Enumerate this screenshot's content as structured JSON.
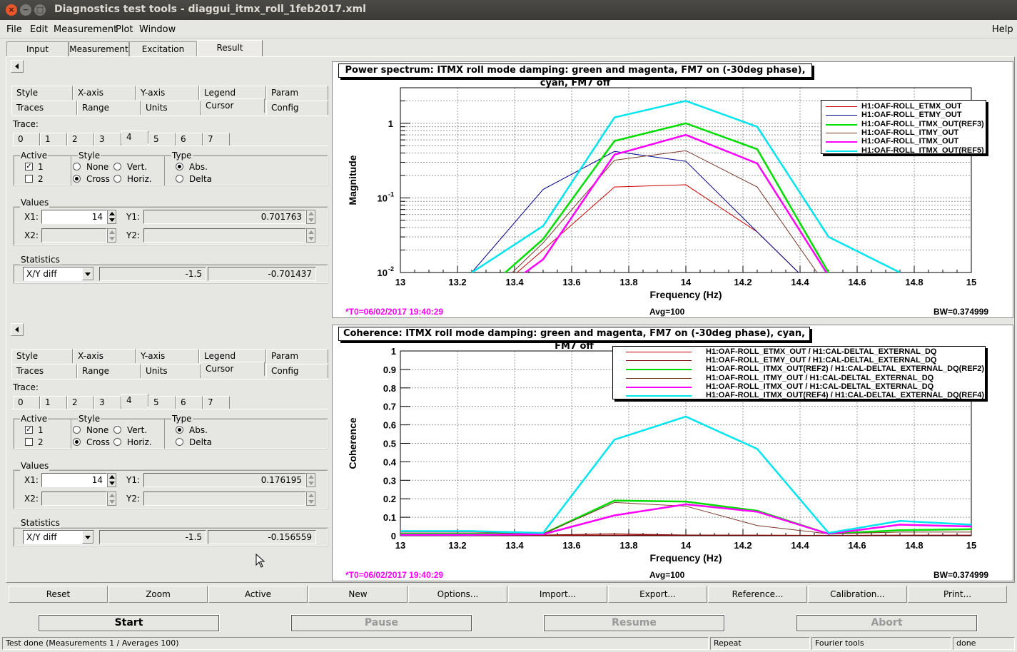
{
  "window": {
    "title": "Diagnostics test tools - diaggui_itmx_roll_1feb2017.xml",
    "controls": [
      "×",
      "−",
      "□"
    ]
  },
  "menubar": {
    "items": [
      "File",
      "Edit",
      "Measurement",
      "Plot",
      "Window"
    ],
    "help": "Help"
  },
  "main_tabs": [
    "Input",
    "Measurement",
    "Excitation",
    "Result"
  ],
  "panel_top": {
    "tabs_row1": [
      "Style",
      "X-axis",
      "Y-axis",
      "Legend",
      "Param"
    ],
    "tabs_row2": [
      "Traces",
      "Range",
      "Units",
      "Cursor",
      "Config"
    ],
    "trace_label": "Trace:",
    "trace_tabs": [
      "0",
      "1",
      "2",
      "3",
      "4",
      "5",
      "6",
      "7"
    ],
    "active_label": "Active",
    "active_1": "1",
    "active_2": "2",
    "style_label": "Style",
    "style_none": "None",
    "style_vert": "Vert.",
    "style_cross": "Cross",
    "style_horiz": "Horiz.",
    "type_label": "Type",
    "type_abs": "Abs.",
    "type_delta": "Delta",
    "values_label": "Values",
    "x1_label": "X1:",
    "x1_value": "14",
    "y1_label": "Y1:",
    "y1_value": "0.701763",
    "x2_label": "X2:",
    "y2_label": "Y2:",
    "statistics_label": "Statistics",
    "stat_select": "X/Y diff",
    "stat_val1": "-1.5",
    "stat_val2": "-0.701437"
  },
  "panel_bottom": {
    "tabs_row1": [
      "Style",
      "X-axis",
      "Y-axis",
      "Legend",
      "Param"
    ],
    "tabs_row2": [
      "Traces",
      "Range",
      "Units",
      "Cursor",
      "Config"
    ],
    "trace_label": "Trace:",
    "trace_tabs": [
      "0",
      "1",
      "2",
      "3",
      "4",
      "5",
      "6",
      "7"
    ],
    "active_label": "Active",
    "active_1": "1",
    "active_2": "2",
    "style_label": "Style",
    "style_none": "None",
    "style_vert": "Vert.",
    "style_cross": "Cross",
    "style_horiz": "Horiz.",
    "type_label": "Type",
    "type_abs": "Abs.",
    "type_delta": "Delta",
    "values_label": "Values",
    "x1_label": "X1:",
    "x1_value": "14",
    "y1_label": "Y1:",
    "y1_value": "0.176195",
    "x2_label": "X2:",
    "y2_label": "Y2:",
    "statistics_label": "Statistics",
    "stat_select": "X/Y diff",
    "stat_val1": "-1.5",
    "stat_val2": "-0.156559"
  },
  "plot_top": {
    "t0": "*T0=06/02/2017 19:40:29",
    "avg": "Avg=100",
    "bw": "BW=0.374999"
  },
  "plot_bottom": {
    "t0": "*T0=06/02/2017 19:40:29",
    "avg": "Avg=100",
    "bw": "BW=0.374999"
  },
  "button_bar": [
    "Reset",
    "Zoom",
    "Active",
    "New",
    "Options...",
    "Import...",
    "Export...",
    "Reference...",
    "Calibration...",
    "Print..."
  ],
  "control_buttons": [
    "Start",
    "Pause",
    "Resume",
    "Abort"
  ],
  "status": {
    "message": "Test done (Measurements 1 / Averages 100)",
    "repeat": "Repeat",
    "tools": "Fourier tools",
    "state": "done"
  },
  "colors": {
    "magenta": "#ff00ff",
    "cyan": "#00e5ee",
    "green": "#00dd00"
  },
  "chart_data": [
    {
      "type": "line",
      "title": "Power spectrum: ITMX roll mode damping: green and magenta, FM7 on (-30deg phase), cyan, FM7 off",
      "xlabel": "Frequency (Hz)",
      "ylabel": "Magnitude",
      "yscale": "log",
      "xlim": [
        13,
        15
      ],
      "ylim": [
        0.01,
        3
      ],
      "xticks": [
        "13",
        "13.2",
        "13.4",
        "13.6",
        "13.8",
        "14",
        "14.2",
        "14.4",
        "14.6",
        "14.8",
        "15"
      ],
      "yticks": [
        "1",
        "10^-1",
        "10^-2"
      ],
      "grid": true,
      "legend": "top-right",
      "x": [
        13.25,
        13.5,
        13.75,
        14,
        14.25,
        14.5,
        14.75
      ],
      "series": [
        {
          "name": "H1:OAF-ROLL_ETMX_OUT",
          "color": "#cc0000",
          "width": 1,
          "values": [
            0.003,
            0.02,
            0.14,
            0.15,
            0.035,
            0.004,
            0.001
          ]
        },
        {
          "name": "H1:OAF-ROLL_ETMY_OUT",
          "color": "#00008b",
          "width": 1,
          "values": [
            0.01,
            0.13,
            0.42,
            0.31,
            0.035,
            0.004,
            0.001
          ]
        },
        {
          "name": "H1:OAF-ROLL_ITMX_OUT(REF3)",
          "color": "#00dd00",
          "width": 2.5,
          "values": [
            0.004,
            0.028,
            0.58,
            1.0,
            0.45,
            0.01,
            0.003
          ]
        },
        {
          "name": "H1:OAF-ROLL_ITMY_OUT",
          "color": "#7a3a2a",
          "width": 1,
          "values": [
            0.003,
            0.025,
            0.32,
            0.43,
            0.14,
            0.006,
            0.002
          ]
        },
        {
          "name": "H1:OAF-ROLL_ITMX_OUT",
          "color": "#ff00ff",
          "width": 2.5,
          "values": [
            0.003,
            0.015,
            0.38,
            0.7,
            0.29,
            0.009,
            0.002
          ]
        },
        {
          "name": "H1:OAF-ROLL_ITMX_OUT(REF5)",
          "color": "#00e5ee",
          "width": 2.5,
          "values": [
            0.01,
            0.042,
            1.2,
            2.0,
            0.9,
            0.03,
            0.01
          ]
        }
      ]
    },
    {
      "type": "line",
      "title": "Coherence: ITMX roll mode damping: green and magenta, FM7 on (-30deg phase), cyan, FM7 off",
      "xlabel": "Frequency (Hz)",
      "ylabel": "Coherence",
      "xlim": [
        13,
        15
      ],
      "ylim": [
        0,
        1
      ],
      "xticks": [
        "13",
        "13.2",
        "13.4",
        "13.6",
        "13.8",
        "14",
        "14.2",
        "14.4",
        "14.6",
        "14.8",
        "15"
      ],
      "yticks": [
        "0",
        "0.1",
        "0.2",
        "0.3",
        "0.4",
        "0.5",
        "0.6",
        "0.7",
        "0.8",
        "0.9",
        "1"
      ],
      "grid": true,
      "legend": "top-right",
      "x": [
        13,
        13.25,
        13.5,
        13.75,
        14,
        14.25,
        14.5,
        14.75,
        15
      ],
      "series": [
        {
          "name": "H1:OAF-ROLL_ETMX_OUT / H1:CAL-DELTAL_EXTERNAL_DQ",
          "color": "#cc0000",
          "width": 1,
          "values": [
            0.003,
            0.003,
            0.002,
            0.004,
            0.003,
            0.003,
            0.002,
            0.003,
            0.003
          ]
        },
        {
          "name": "H1:OAF-ROLL_ETMY_OUT / H1:CAL-DELTAL_EXTERNAL_DQ",
          "color": "#7a0000",
          "width": 1,
          "values": [
            0.004,
            0.003,
            0.004,
            0.01,
            0.004,
            0.003,
            0.002,
            0.003,
            0.003
          ]
        },
        {
          "name": "H1:OAF-ROLL_ITMX_OUT(REF2) / H1:CAL-DELTAL_EXTERNAL_DQ(REF2)",
          "color": "#00dd00",
          "width": 2.5,
          "values": [
            0.01,
            0.01,
            0.01,
            0.19,
            0.185,
            0.135,
            0.01,
            0.03,
            0.035
          ]
        },
        {
          "name": "H1:OAF-ROLL_ITMY_OUT / H1:CAL-DELTAL_EXTERNAL_DQ",
          "color": "#7a3a2a",
          "width": 1,
          "values": [
            0.02,
            0.02,
            0.01,
            0.18,
            0.16,
            0.055,
            0.01,
            0.02,
            0.02
          ]
        },
        {
          "name": "H1:OAF-ROLL_ITMX_OUT / H1:CAL-DELTAL_EXTERNAL_DQ",
          "color": "#ff00ff",
          "width": 2.5,
          "values": [
            0.005,
            0.005,
            0.008,
            0.11,
            0.17,
            0.13,
            0.01,
            0.06,
            0.05
          ]
        },
        {
          "name": "H1:OAF-ROLL_ITMX_OUT(REF4) / H1:CAL-DELTAL_EXTERNAL_DQ(REF4)",
          "color": "#00e5ee",
          "width": 2.5,
          "values": [
            0.025,
            0.025,
            0.015,
            0.52,
            0.645,
            0.47,
            0.015,
            0.08,
            0.06
          ]
        }
      ]
    }
  ]
}
